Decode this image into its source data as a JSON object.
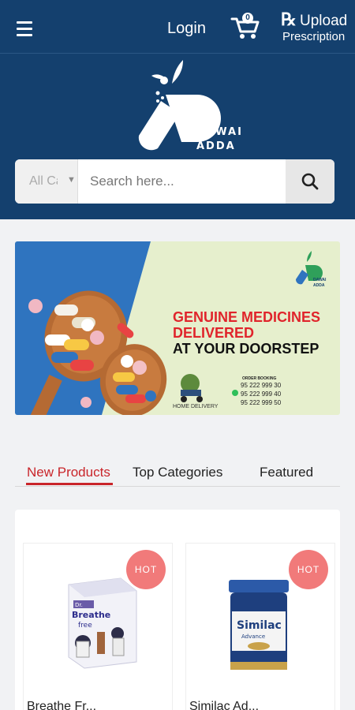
{
  "header": {
    "login_label": "Login",
    "cart_count": "0",
    "rx_symbol": "℞",
    "upload_line1": "Upload",
    "upload_line2": "Prescription",
    "logo_line1": "DAWAI",
    "logo_line2": "ADDA"
  },
  "search": {
    "category_value": "All Ca",
    "placeholder": "Search here..."
  },
  "banner": {
    "headline_red_1": "GENUINE MEDICINES",
    "headline_red_2": "DELIVERED",
    "headline_black": "AT YOUR DOORSTEP",
    "order_label": "ORDER BOOKING",
    "phones": [
      "95 222 999 30",
      "95 222 999 40",
      "95 222 999 50"
    ],
    "home_delivery": "HOME DELIVERY",
    "mini_logo_1": "DAWAI",
    "mini_logo_2": "ADDA"
  },
  "tabs": [
    {
      "label": "New Products",
      "active": true
    },
    {
      "label": "Top Categories",
      "active": false
    },
    {
      "label": "Featured",
      "active": false
    }
  ],
  "products": [
    {
      "name": "Breathe Fr...",
      "badge": "HOT"
    },
    {
      "name": "Similac Ad...",
      "badge": "HOT"
    }
  ],
  "colors": {
    "header_bg": "#14406e",
    "accent_red": "#c9252a",
    "hot_badge": "#f17a7a"
  }
}
